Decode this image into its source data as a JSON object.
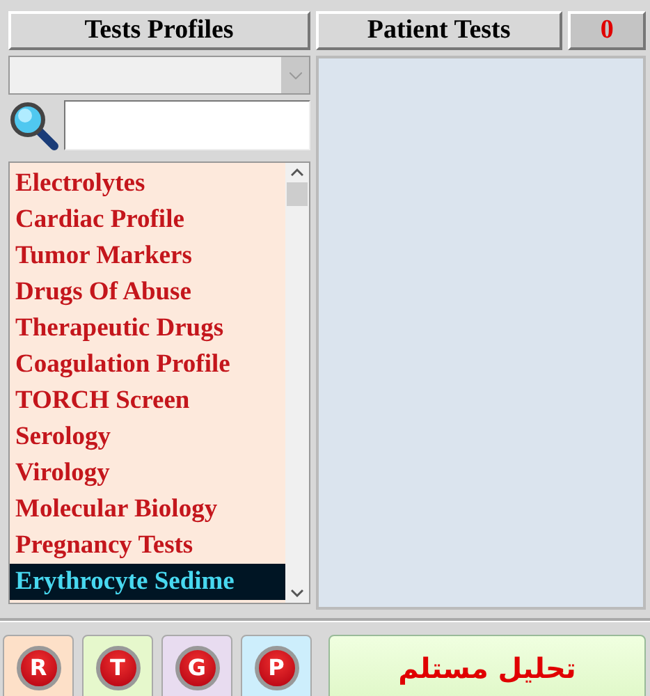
{
  "headers": {
    "profiles": "Tests Profiles",
    "patient": "Patient Tests",
    "count": "0"
  },
  "profile_list": [
    {
      "label": "Electrolytes",
      "selected": false
    },
    {
      "label": "Cardiac Profile",
      "selected": false
    },
    {
      "label": "Tumor Markers",
      "selected": false
    },
    {
      "label": "Drugs Of Abuse",
      "selected": false
    },
    {
      "label": "Therapeutic Drugs",
      "selected": false
    },
    {
      "label": "Coagulation Profile",
      "selected": false
    },
    {
      "label": "TORCH Screen",
      "selected": false
    },
    {
      "label": "Serology",
      "selected": false
    },
    {
      "label": "Virology",
      "selected": false
    },
    {
      "label": "Molecular Biology",
      "selected": false
    },
    {
      "label": "Pregnancy Tests",
      "selected": false
    },
    {
      "label": "Erythrocyte Sedime",
      "selected": true
    }
  ],
  "letter_buttons": [
    {
      "label": "R",
      "color": "#fde0c8"
    },
    {
      "label": "T",
      "color": "#e6f8cc"
    },
    {
      "label": "G",
      "color": "#e8dcf0"
    },
    {
      "label": "P",
      "color": "#cdeefc"
    }
  ],
  "receive_button": "تحليل مستلم"
}
